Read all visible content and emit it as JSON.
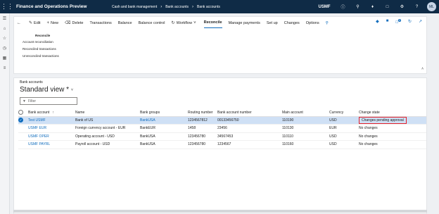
{
  "topbar": {
    "app_title": "Finance and Operations Preview",
    "breadcrumb": [
      "Cash and bank management",
      "Bank accounts",
      "Bank accounts"
    ],
    "company": "USMF",
    "avatar": "ML"
  },
  "actionbar": {
    "edit": "Edit",
    "new": "New",
    "delete": "Delete",
    "transactions": "Transactions",
    "balance": "Balance",
    "balance_control": "Balance control",
    "workflow": "Workflow",
    "reconcile": "Reconcile",
    "manage_payments": "Manage payments",
    "set_up": "Set up",
    "changes": "Changes",
    "options": "Options",
    "notification_count": "0"
  },
  "reconcile_group": {
    "title": "Reconcile",
    "links": [
      "Account reconciliation",
      "Reconciled transactions",
      "Unreconciled transactions"
    ]
  },
  "list": {
    "caption": "Bank accounts",
    "view_name": "Standard view *",
    "filter_placeholder": "Filter",
    "columns": [
      "Bank account",
      "Name",
      "Bank groups",
      "Routing number",
      "Bank account number",
      "Main account",
      "Currency",
      "Change state"
    ],
    "rows": [
      {
        "bank_account": "Test USMF",
        "name": "Bank of US",
        "bank_group": "BankUSA",
        "routing": "1234567812",
        "account_number": "00133456750",
        "main_account": "110190",
        "currency": "USD",
        "change_state": "Changes pending approval"
      },
      {
        "bank_account": "USMF EUR",
        "name": "Foreign currency account - EUR",
        "bank_group": "BankEUR",
        "routing": "1458",
        "account_number": "23456",
        "main_account": "110130",
        "currency": "EUR",
        "change_state": "No changes"
      },
      {
        "bank_account": "USMF OPER",
        "name": "Operating account - USD",
        "bank_group": "BankUSA",
        "routing": "123456780",
        "account_number": "34567453",
        "main_account": "110110",
        "currency": "USD",
        "change_state": "No changes"
      },
      {
        "bank_account": "USMF PAYRL",
        "name": "Payroll account - USD",
        "bank_group": "BankUSA",
        "routing": "123456780",
        "account_number": "1234567",
        "main_account": "110160",
        "currency": "USD",
        "change_state": "No changes"
      }
    ]
  },
  "colors": {
    "topbar": "#0f2b46",
    "accent": "#0f6cbd",
    "selected_row": "#cfe0f5",
    "highlight_box": "#e0202c"
  }
}
